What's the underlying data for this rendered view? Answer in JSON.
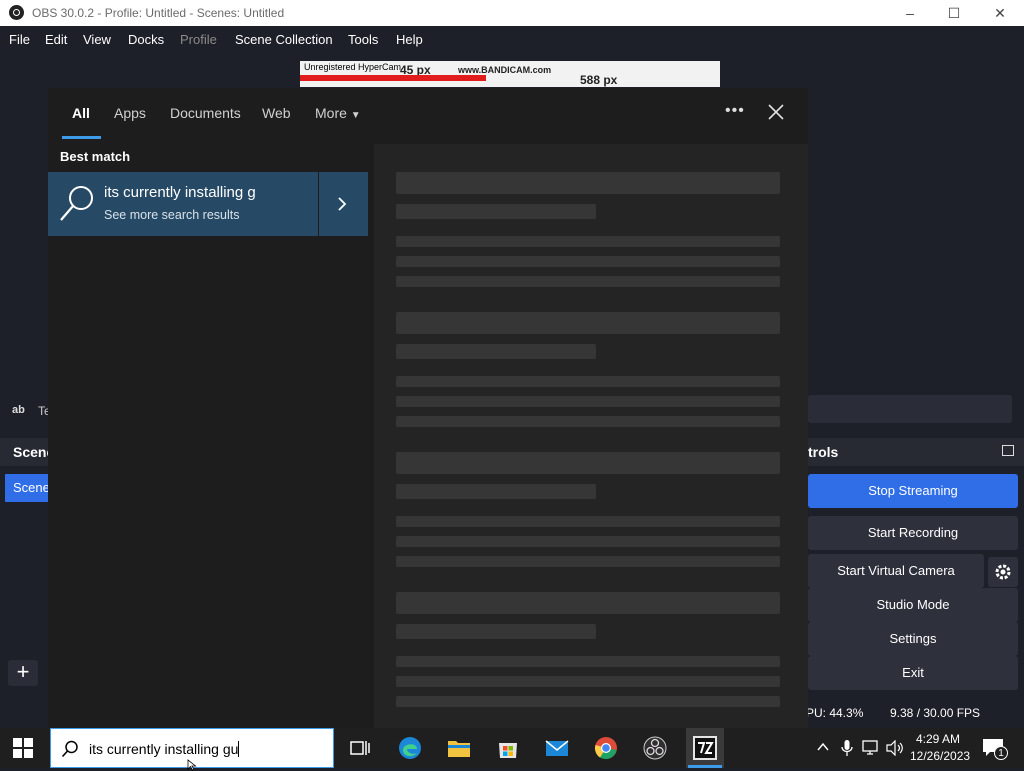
{
  "window": {
    "title": "OBS 30.0.2 - Profile: Untitled - Scenes: Untitled"
  },
  "menu": [
    "File",
    "Edit",
    "View",
    "Docks",
    "Profile",
    "Scene Collection",
    "Tools",
    "Help"
  ],
  "preview_strip": {
    "watermark1": "Unregistered HyperCam",
    "px1": "45 px",
    "watermark2": "www.BANDICAM.com",
    "px2": "588 px"
  },
  "source_row": {
    "icon_label": "ab",
    "label": "Te"
  },
  "scenes_dock": {
    "title": "Scene",
    "item": "Scene",
    "add_label": "+"
  },
  "controls_dock": {
    "title": "trols",
    "stop_streaming": "Stop Streaming",
    "start_recording": "Start Recording",
    "start_virtual_camera": "Start Virtual Camera",
    "studio_mode": "Studio Mode",
    "settings": "Settings",
    "exit": "Exit"
  },
  "status": {
    "cpu": "PU: 44.3%",
    "fps": "9.38 / 30.00 FPS"
  },
  "search_panel": {
    "tabs": [
      "All",
      "Apps",
      "Documents",
      "Web",
      "More"
    ],
    "best_match_label": "Best match",
    "query_result": "its currently installing g",
    "see_more": "See more search results"
  },
  "taskbar": {
    "search_text": "its currently installing gu",
    "time": "4:29 AM",
    "date": "12/26/2023",
    "notifications_count": "1"
  },
  "colors": {
    "accent": "#2f6ee6",
    "selection": "#264a66",
    "obs_bg": "#1e2029",
    "search_bg": "#1d1d1d"
  }
}
